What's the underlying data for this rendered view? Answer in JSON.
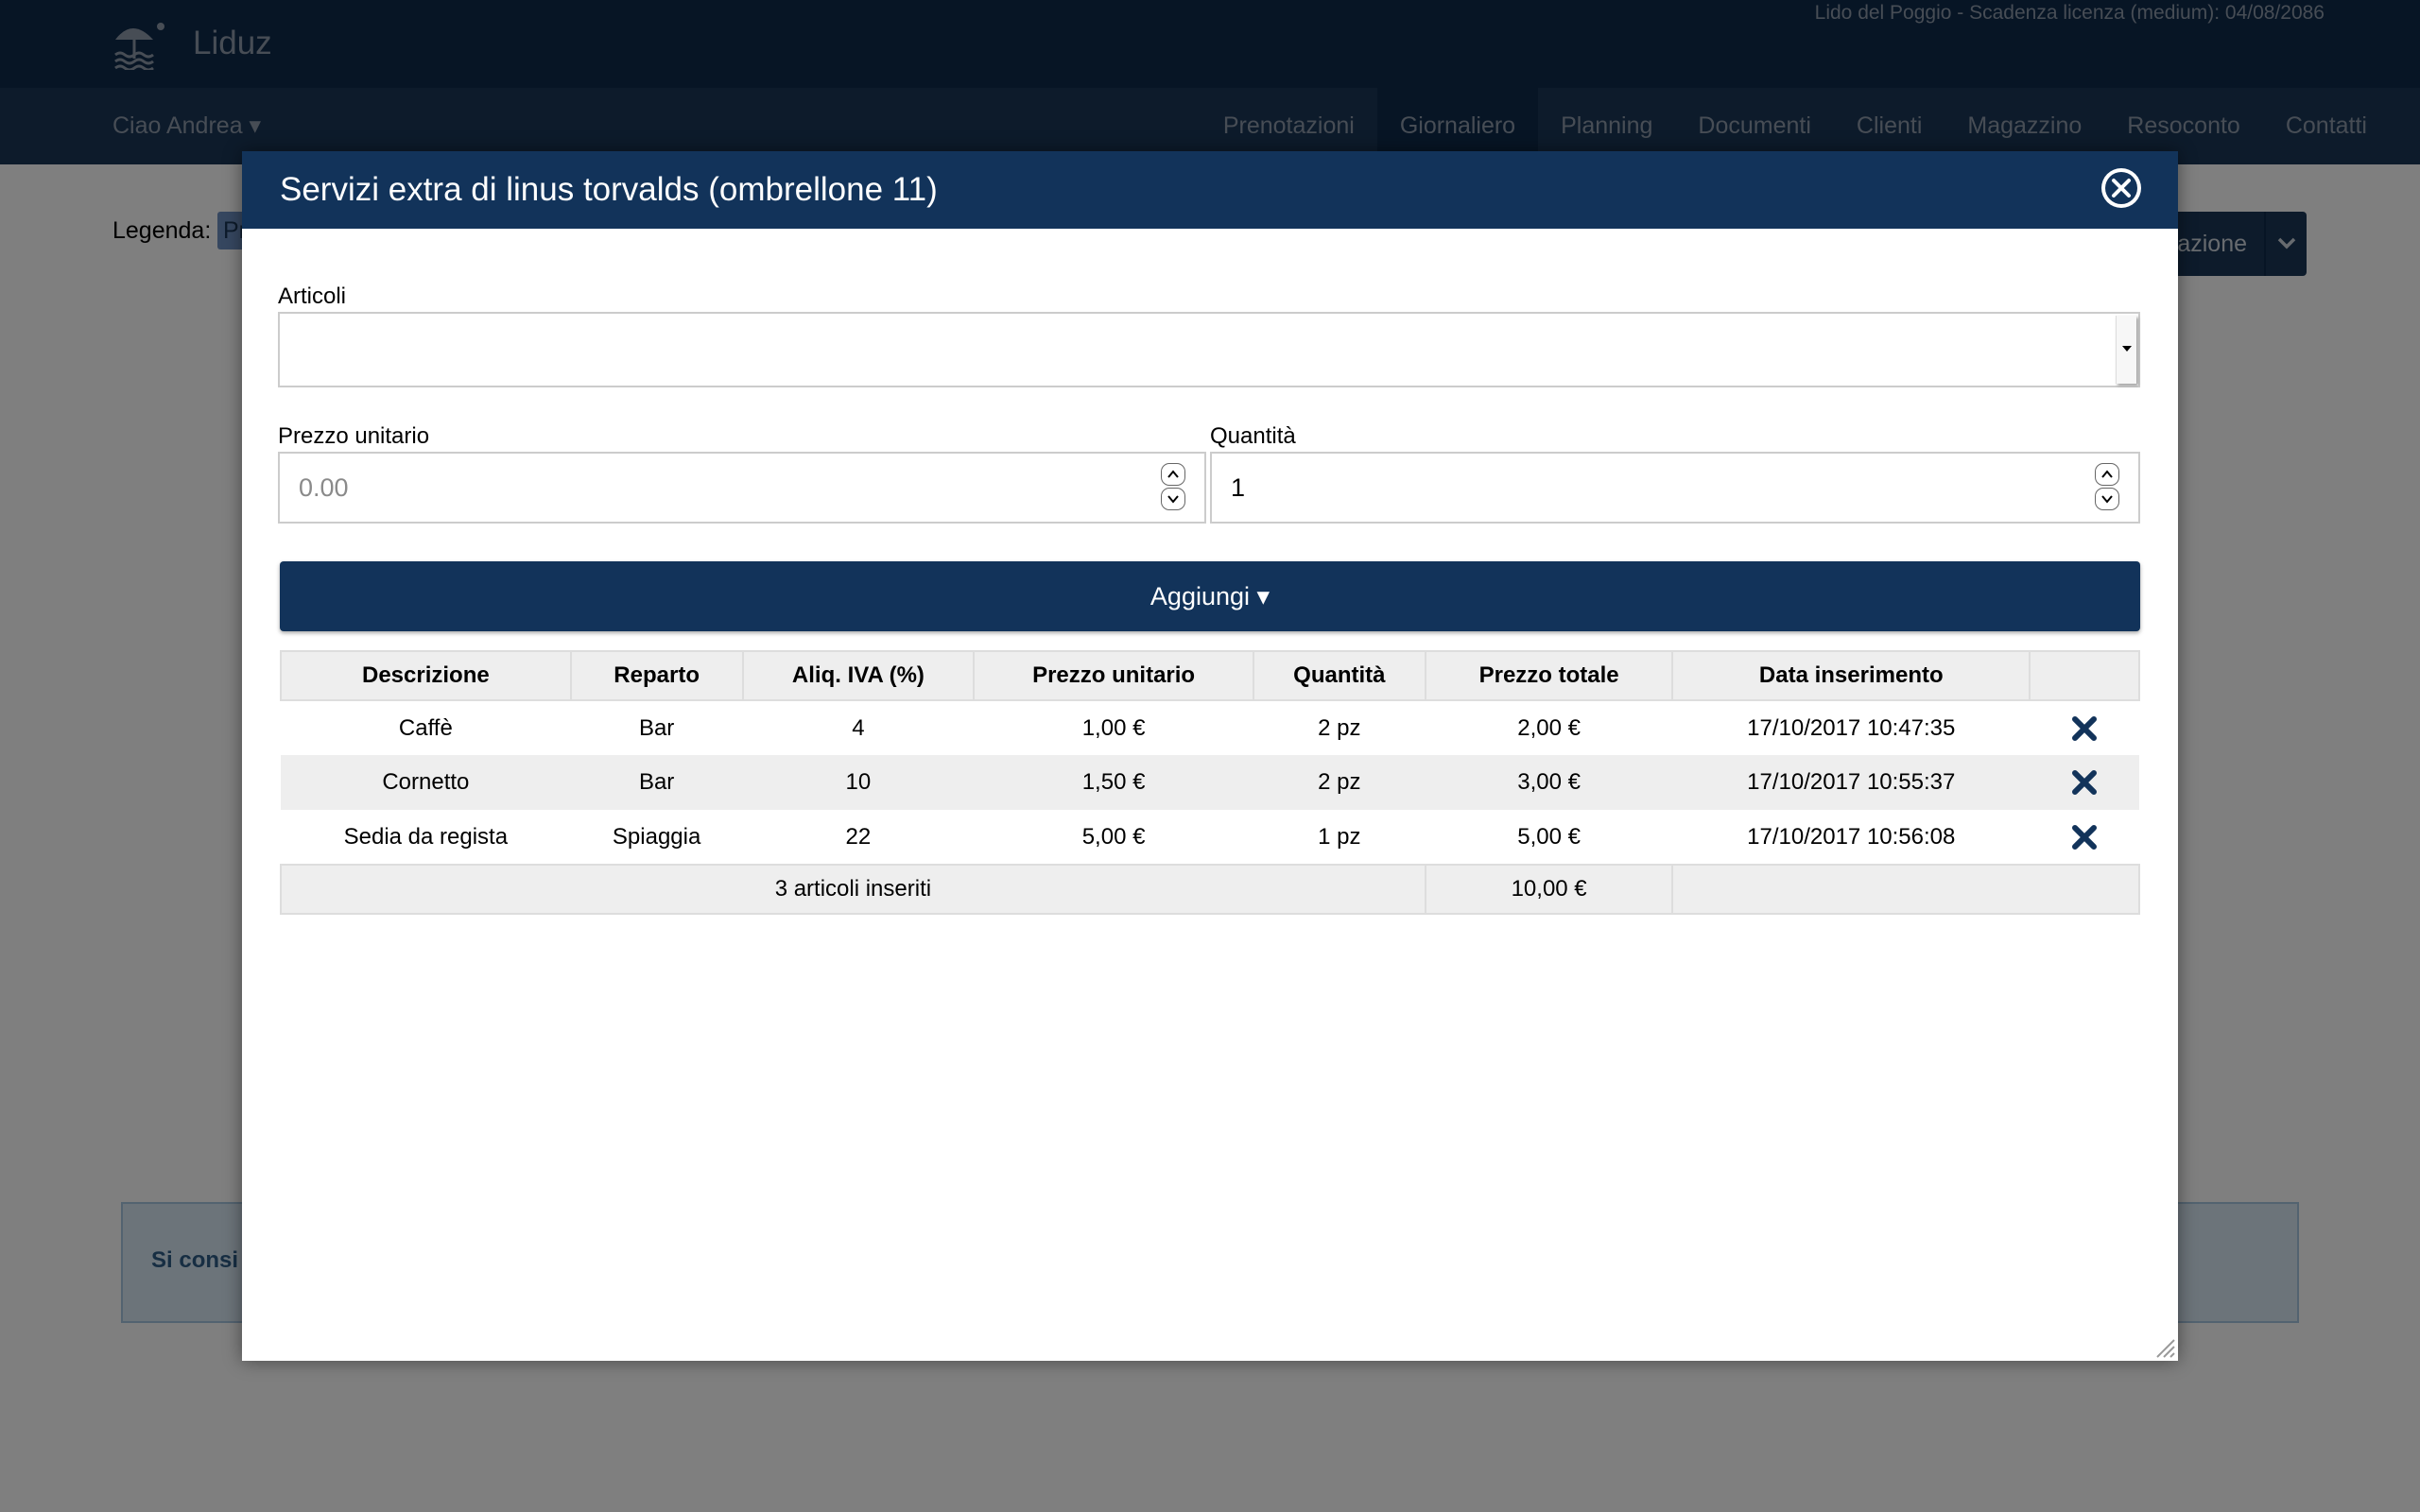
{
  "app": {
    "name": "Liduz",
    "license_info": "Lido del Poggio - Scadenza licenza (medium): 04/08/2086"
  },
  "navbar": {
    "user_menu": "Ciao Andrea ▾",
    "items": [
      {
        "label": "Prenotazioni",
        "active": false
      },
      {
        "label": "Giornaliero",
        "active": true
      },
      {
        "label": "Planning",
        "active": false
      },
      {
        "label": "Documenti",
        "active": false
      },
      {
        "label": "Clienti",
        "active": false
      },
      {
        "label": "Magazzino",
        "active": false
      },
      {
        "label": "Resoconto",
        "active": false
      },
      {
        "label": "Contatti",
        "active": false
      }
    ]
  },
  "background": {
    "legend_label": "Legenda:",
    "legend_chip_text": "Pr",
    "action_button_text": "azione",
    "info_text": "Si consi"
  },
  "modal": {
    "title": "Servizi extra di linus torvalds (ombrellone 11)",
    "articoli_label": "Articoli",
    "articoli_value": "",
    "prezzo_label": "Prezzo unitario",
    "prezzo_placeholder": "0.00",
    "quantita_label": "Quantità",
    "quantita_value": "1",
    "add_button": "Aggiungi ▾",
    "table": {
      "headers": [
        "Descrizione",
        "Reparto",
        "Aliq. IVA (%)",
        "Prezzo unitario",
        "Quantità",
        "Prezzo totale",
        "Data inserimento",
        ""
      ],
      "rows": [
        [
          "Caffè",
          "Bar",
          "4",
          "1,00 €",
          "2 pz",
          "2,00 €",
          "17/10/2017 10:47:35"
        ],
        [
          "Cornetto",
          "Bar",
          "10",
          "1,50 €",
          "2 pz",
          "3,00 €",
          "17/10/2017 10:55:37"
        ],
        [
          "Sedia da regista",
          "Spiaggia",
          "22",
          "5,00 €",
          "1 pz",
          "5,00 €",
          "17/10/2017 10:56:08"
        ]
      ],
      "footer_count": "3 articoli inseriti",
      "footer_total": "10,00 €"
    }
  },
  "colors": {
    "topbar": "#0f2a4b",
    "navbar": "#1b3656",
    "modal_header": "#12335a",
    "accent": "#12335a"
  },
  "icons": {
    "logo": "beach-umbrella-icon",
    "close": "close-circle-icon",
    "delete": "delete-x-icon",
    "caret": "chevron-down-icon"
  }
}
